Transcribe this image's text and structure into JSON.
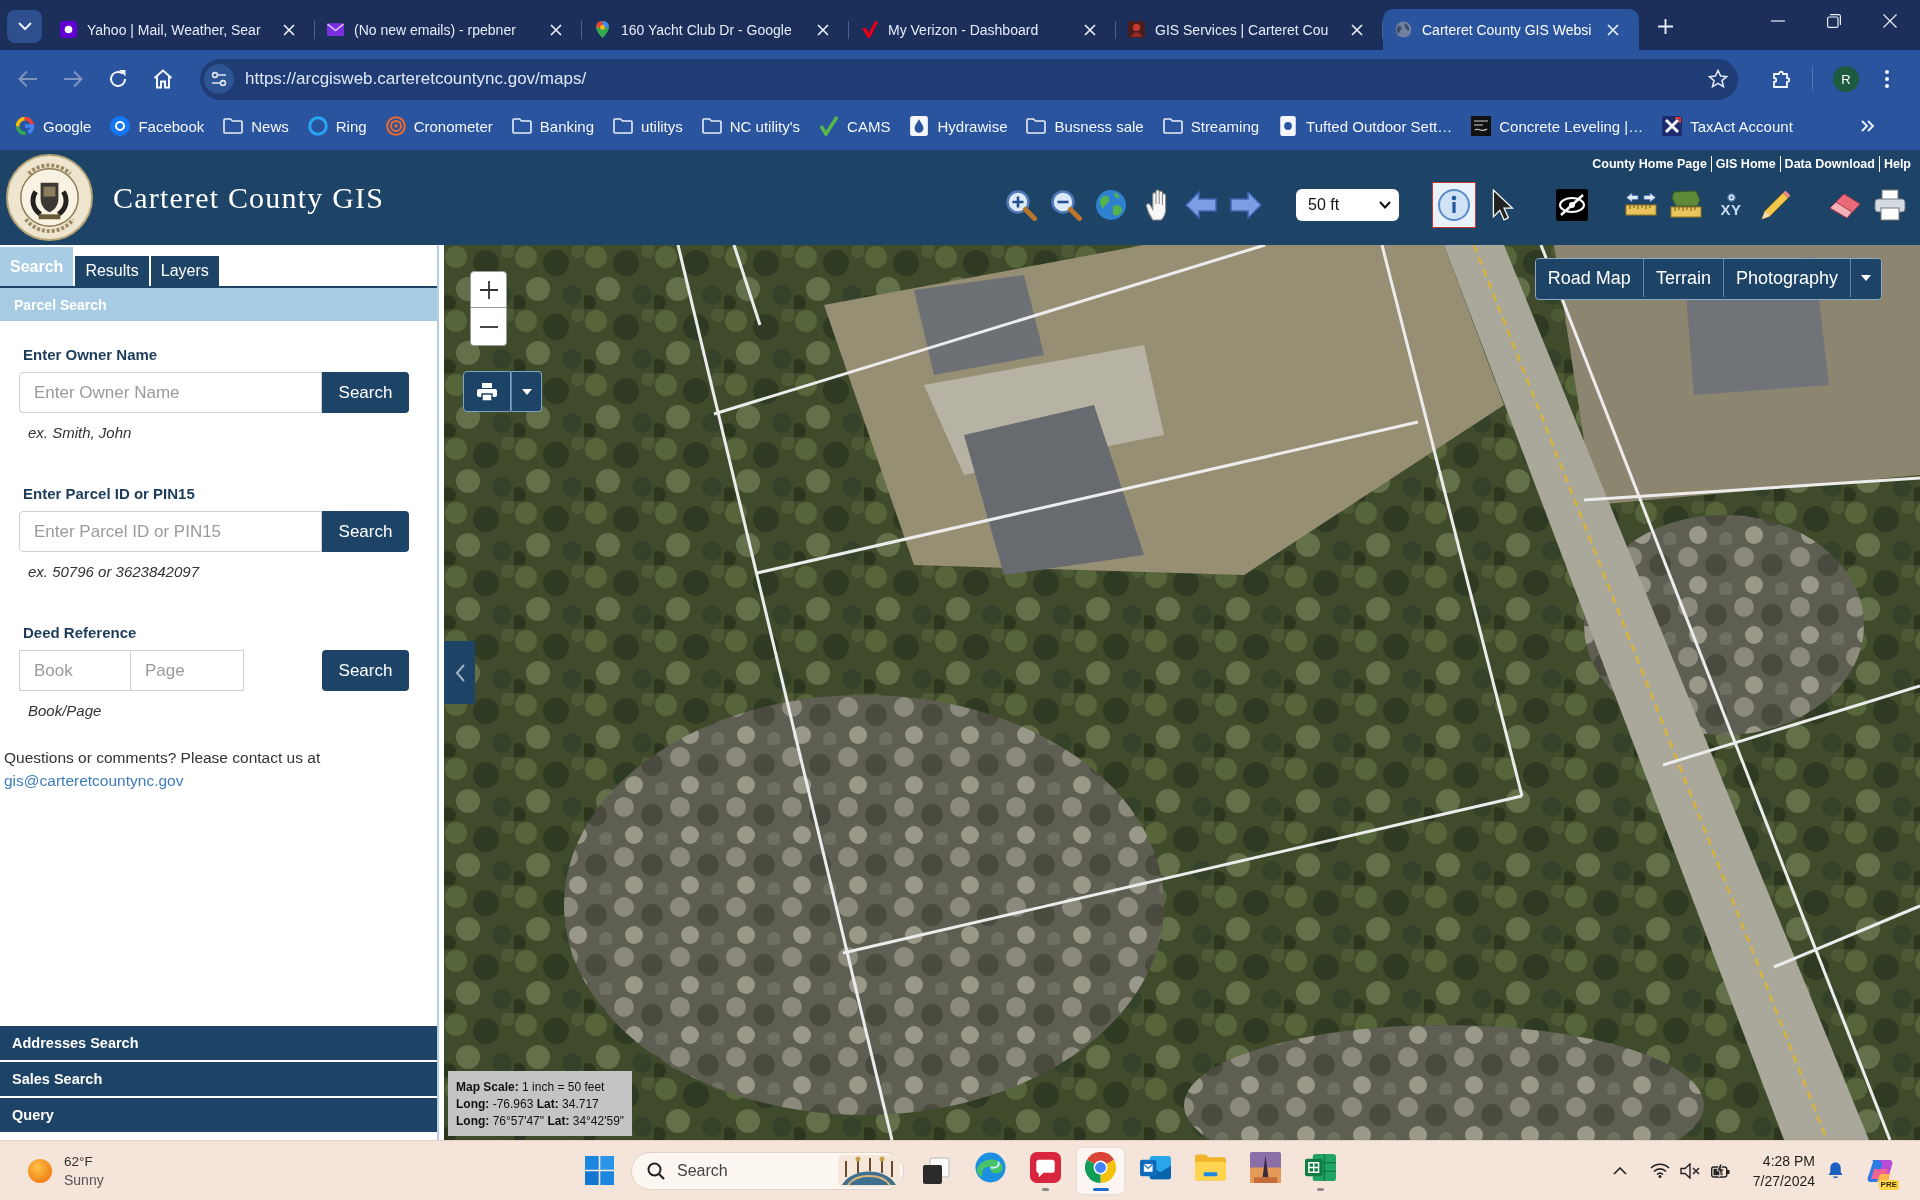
{
  "browser": {
    "tabs": [
      {
        "title": "Yahoo | Mail, Weather, Sear",
        "selected": false
      },
      {
        "title": "(No new emails) - rpebner",
        "selected": false
      },
      {
        "title": "160 Yacht Club Dr - Google",
        "selected": false
      },
      {
        "title": "My Verizon - Dashboard",
        "selected": false
      },
      {
        "title": "GIS Services | Carteret Cou",
        "selected": false
      },
      {
        "title": "Carteret County GIS Websi",
        "selected": true
      }
    ],
    "nav_buttons": [
      {
        "kind": "back",
        "disabled": true
      },
      {
        "kind": "forward",
        "disabled": true
      },
      {
        "kind": "reload",
        "disabled": false
      },
      {
        "kind": "home",
        "disabled": false
      }
    ],
    "url": "https://arcgisweb.carteretcountync.gov/maps/",
    "profile_initial": "R",
    "bookmarks": [
      {
        "label": "Google",
        "kind": "site"
      },
      {
        "label": "Facebook",
        "kind": "site"
      },
      {
        "label": "News",
        "kind": "folder"
      },
      {
        "label": "Ring",
        "kind": "site"
      },
      {
        "label": "Cronometer",
        "kind": "site"
      },
      {
        "label": "Banking",
        "kind": "folder"
      },
      {
        "label": "utilitys",
        "kind": "folder"
      },
      {
        "label": "NC utility's",
        "kind": "folder"
      },
      {
        "label": "CAMS",
        "kind": "site"
      },
      {
        "label": "Hydrawise",
        "kind": "site"
      },
      {
        "label": "Busness sale",
        "kind": "folder"
      },
      {
        "label": "Streaming",
        "kind": "folder"
      },
      {
        "label": "Tufted Outdoor Sett…",
        "kind": "site"
      },
      {
        "label": "Concrete Leveling |…",
        "kind": "site"
      },
      {
        "label": "TaxAct Account",
        "kind": "site"
      }
    ]
  },
  "header": {
    "title": "Carteret County GIS",
    "links": [
      "County Home Page",
      "GIS Home",
      "Data Download",
      "Help"
    ],
    "nav_tools": [
      {
        "kind": "zoom-in",
        "selected": false
      },
      {
        "kind": "zoom-out",
        "selected": false
      },
      {
        "kind": "full-extent",
        "selected": false
      },
      {
        "kind": "pan",
        "selected": false
      },
      {
        "kind": "previous",
        "selected": false
      },
      {
        "kind": "next",
        "selected": false
      }
    ],
    "scale": "50 ft",
    "tool_groups": [
      [
        {
          "kind": "identify",
          "selected": true
        },
        {
          "kind": "select",
          "selected": false
        }
      ],
      [
        {
          "kind": "hide",
          "selected": false
        }
      ],
      [
        {
          "kind": "measure-distance",
          "selected": false
        },
        {
          "kind": "measure-area",
          "selected": false
        },
        {
          "kind": "xy",
          "label": "XY",
          "selected": false
        },
        {
          "kind": "draw",
          "selected": false
        }
      ],
      [
        {
          "kind": "erase",
          "selected": false
        },
        {
          "kind": "print",
          "selected": false
        }
      ]
    ]
  },
  "panel": {
    "tabs": [
      {
        "label": "Search",
        "selected": true
      },
      {
        "label": "Results",
        "selected": false
      },
      {
        "label": "Layers",
        "selected": false
      }
    ],
    "sections": [
      {
        "title": "Parcel Search",
        "expanded": true,
        "forms": [
          {
            "label": "Enter Owner Name",
            "fields": [
              {
                "placeholder": "Enter Owner Name"
              }
            ],
            "button": "Search",
            "hint": "ex. Smith, John"
          },
          {
            "label": "Enter Parcel ID or PIN15",
            "fields": [
              {
                "placeholder": "Enter Parcel ID or PIN15"
              }
            ],
            "button": "Search",
            "hint": "ex. 50796 or 3623842097"
          },
          {
            "label": "Deed Reference",
            "fields": [
              {
                "placeholder": "Book"
              },
              {
                "placeholder": "Page"
              }
            ],
            "button": "Search",
            "hint": "Book/Page"
          }
        ],
        "contact": {
          "text": "Questions or comments? Please contact us at",
          "link": "gis@carteretcountync.gov"
        }
      },
      {
        "title": "Addresses Search",
        "expanded": false
      },
      {
        "title": "Sales Search",
        "expanded": false
      },
      {
        "title": "Query",
        "expanded": false
      }
    ]
  },
  "map": {
    "basemaps": [
      "Road Map",
      "Terrain",
      "Photography"
    ],
    "info": [
      "**Map Scale:** 1 inch = 50 feet",
      "**Long:** -76.963 **Lat:** 34.717",
      "**Long:** 76°57'47\" **Lat:** 34°42'59\""
    ]
  },
  "taskbar": {
    "weather": {
      "temperature": "62°F",
      "condition": "Sunny"
    },
    "search": {
      "placeholder": "Search"
    },
    "apps": [
      {
        "kind": "swirl",
        "running": false,
        "selected": false
      },
      {
        "kind": "bubble",
        "running": true,
        "selected": false
      },
      {
        "kind": "circle",
        "running": true,
        "selected": true
      },
      {
        "kind": "mail",
        "running": false,
        "selected": false
      },
      {
        "kind": "folder",
        "running": false,
        "selected": false
      },
      {
        "kind": "picture",
        "running": false,
        "selected": false
      },
      {
        "kind": "sheet",
        "running": true,
        "selected": false
      }
    ],
    "volume_muted": true,
    "time": "4:28 PM",
    "date": "7/27/2024",
    "badge": "PRE"
  }
}
